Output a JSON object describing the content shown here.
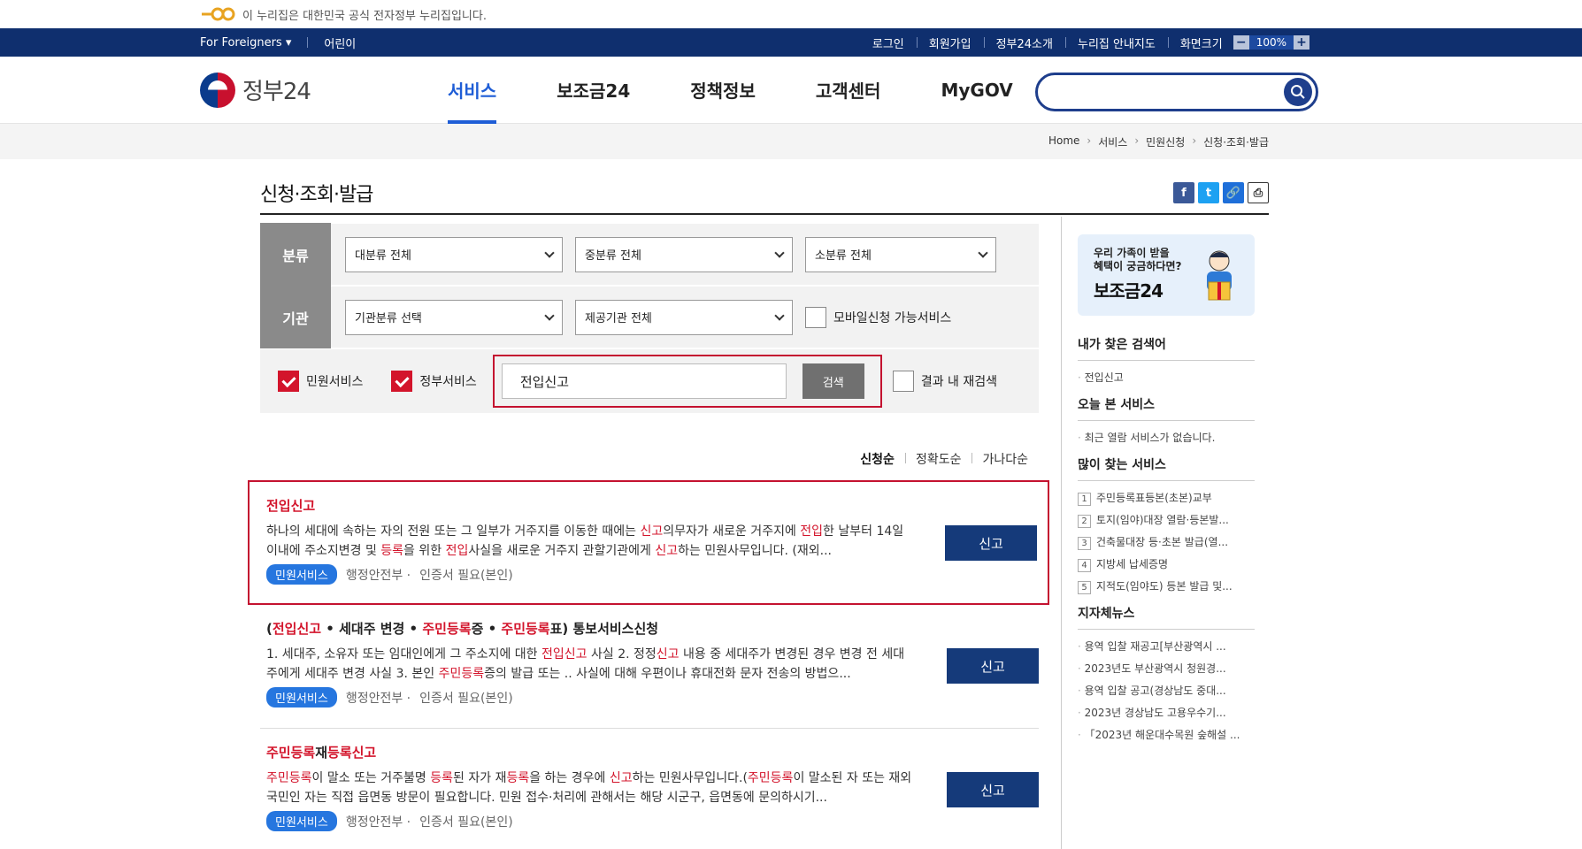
{
  "notice": {
    "text": "이 누리집은 대한민국 공식 전자정부 누리집입니다."
  },
  "utilbar": {
    "left": [
      "For Foreigners ▾",
      "어린이"
    ],
    "right": [
      "로그인",
      "회원가입",
      "정부24소개",
      "누리집 안내지도"
    ],
    "zoom_label": "화면크기",
    "zoom_minus": "−",
    "zoom_value": "100%",
    "zoom_plus": "+"
  },
  "brand": {
    "name": "정부24"
  },
  "gnb": {
    "menu": [
      "서비스",
      "보조금24",
      "정책정보",
      "고객센터",
      "MyGOV"
    ],
    "active_index": 0
  },
  "search": {
    "placeholder": "",
    "value": ""
  },
  "breadcrumb": [
    "Home",
    "서비스",
    "민원신청",
    "신청·조회·발급"
  ],
  "page": {
    "title": "신청·조회·발급"
  },
  "share": {
    "facebook": "f",
    "twitter": "t",
    "link": "🔗",
    "print": "⎙"
  },
  "filter": {
    "row1_label": "분류",
    "row1": [
      "대분류 전체",
      "중분류 전체",
      "소분류 전체"
    ],
    "row2_label": "기관",
    "row2": [
      "기관분류 선택",
      "제공기관 전체"
    ],
    "mobile_check": "모바일신청 가능서비스",
    "civil_check": "민원서비스",
    "gov_check": "정부서비스",
    "keyword": "전입신고",
    "search_button": "검색",
    "research_check": "결과 내 재검색"
  },
  "sort": [
    "신청순",
    "정확도순",
    "가나다순"
  ],
  "results": [
    {
      "title_parts": [
        {
          "t": "전입신고",
          "red": true
        }
      ],
      "desc_parts": [
        {
          "t": "하나의 세대에 속하는 자의 전원 또는 그 일부가 거주지를 이동한 때에는 ",
          "red": false
        },
        {
          "t": "신고",
          "red": true
        },
        {
          "t": "의무자가 새로운 거주지에 ",
          "red": false
        },
        {
          "t": "전입",
          "red": true
        },
        {
          "t": "한 날부터 14일 이내에 주소지변경 및 ",
          "red": false
        },
        {
          "t": "등록",
          "red": true
        },
        {
          "t": "을 위한 ",
          "red": false
        },
        {
          "t": "전입",
          "red": true
        },
        {
          "t": "사실을 새로운 거주지 관할기관에게 ",
          "red": false
        },
        {
          "t": "신고",
          "red": true
        },
        {
          "t": "하는 민원사무입니다. (재외...",
          "red": false
        }
      ],
      "badge": "민원서비스",
      "org": "행정안전부 ·",
      "auth": "인증서 필요(본인)",
      "button": "신고"
    },
    {
      "title_parts": [
        {
          "t": "(",
          "red": false
        },
        {
          "t": "전입신고",
          "red": true
        },
        {
          "t": " • 세대주 변경 • ",
          "red": false
        },
        {
          "t": "주민등록",
          "red": true
        },
        {
          "t": "증 • ",
          "red": false
        },
        {
          "t": "주민등록",
          "red": true
        },
        {
          "t": "표) 통보서비스신청",
          "red": false
        }
      ],
      "desc_parts": [
        {
          "t": "1. 세대주, 소유자 또는 임대인에게 그 주소지에 대한 ",
          "red": false
        },
        {
          "t": "전입신고",
          "red": true
        },
        {
          "t": " 사실 2. 정정",
          "red": false
        },
        {
          "t": "신고",
          "red": true
        },
        {
          "t": " 내용 중 세대주가 변경된 경우 변경 전 세대주에게 세대주 변경 사실 3. 본인 ",
          "red": false
        },
        {
          "t": "주민등록",
          "red": true
        },
        {
          "t": "증의 발급 또는 .. 사실에 대해 우편이나 휴대전화 문자 전송의 방법으...",
          "red": false
        }
      ],
      "badge": "민원서비스",
      "org": "행정안전부 ·",
      "auth": "인증서 필요(본인)",
      "button": "신고"
    },
    {
      "title_parts": [
        {
          "t": "주민등록",
          "red": true
        },
        {
          "t": "재",
          "red": false
        },
        {
          "t": "등록신고",
          "red": true
        }
      ],
      "desc_parts": [
        {
          "t": "주민등록",
          "red": true
        },
        {
          "t": "이 말소 또는 거주불명 ",
          "red": false
        },
        {
          "t": "등록",
          "red": true
        },
        {
          "t": "된 자가 재",
          "red": false
        },
        {
          "t": "등록",
          "red": true
        },
        {
          "t": "을 하는 경우에 ",
          "red": false
        },
        {
          "t": "신고",
          "red": true
        },
        {
          "t": "하는 민원사무입니다.(",
          "red": false
        },
        {
          "t": "주민등록",
          "red": true
        },
        {
          "t": "이 말소된 자 또는 재외국민인 자는 직접 읍면동 방문이 필요합니다. 민원 접수·처리에 관해서는 해당 시군구, 읍면동에 문의하시기...",
          "red": false
        }
      ],
      "badge": "민원서비스",
      "org": "행정안전부 ·",
      "auth": "인증서 필요(본인)",
      "button": "신고"
    }
  ],
  "sidebar": {
    "promo_line1": "우리 가족이 받을",
    "promo_line2": "혜택이 궁금하다면?",
    "promo_title": "보조금24",
    "recent_search_title": "내가 찾은 검색어",
    "recent_search": [
      "전입신고"
    ],
    "today_title": "오늘 본 서비스",
    "today": [
      "최근 열람 서비스가 없습니다."
    ],
    "popular_title": "많이 찾는 서비스",
    "popular": [
      "주민등록표등본(초본)교부",
      "토지(임야)대장 열람·등본발...",
      "건축물대장 등·초본 발급(열...",
      "지방세 납세증명",
      "지적도(임야도) 등본 발급 및..."
    ],
    "news_title": "지자체뉴스",
    "news": [
      "용역 입찰 재공고[부산광역시 ...",
      "2023년도 부산광역시 청원경...",
      "용역 입찰 공고(경상남도 중대...",
      "2023년 경상남도 고용우수기...",
      "「2023년 해운대수목원 숲해설 ..."
    ]
  },
  "colors": {
    "accent": "#1e5dd6",
    "utilbar": "#0f2f6e",
    "highlight": "#c41230",
    "button": "#153a7a",
    "badge": "#2676df"
  }
}
